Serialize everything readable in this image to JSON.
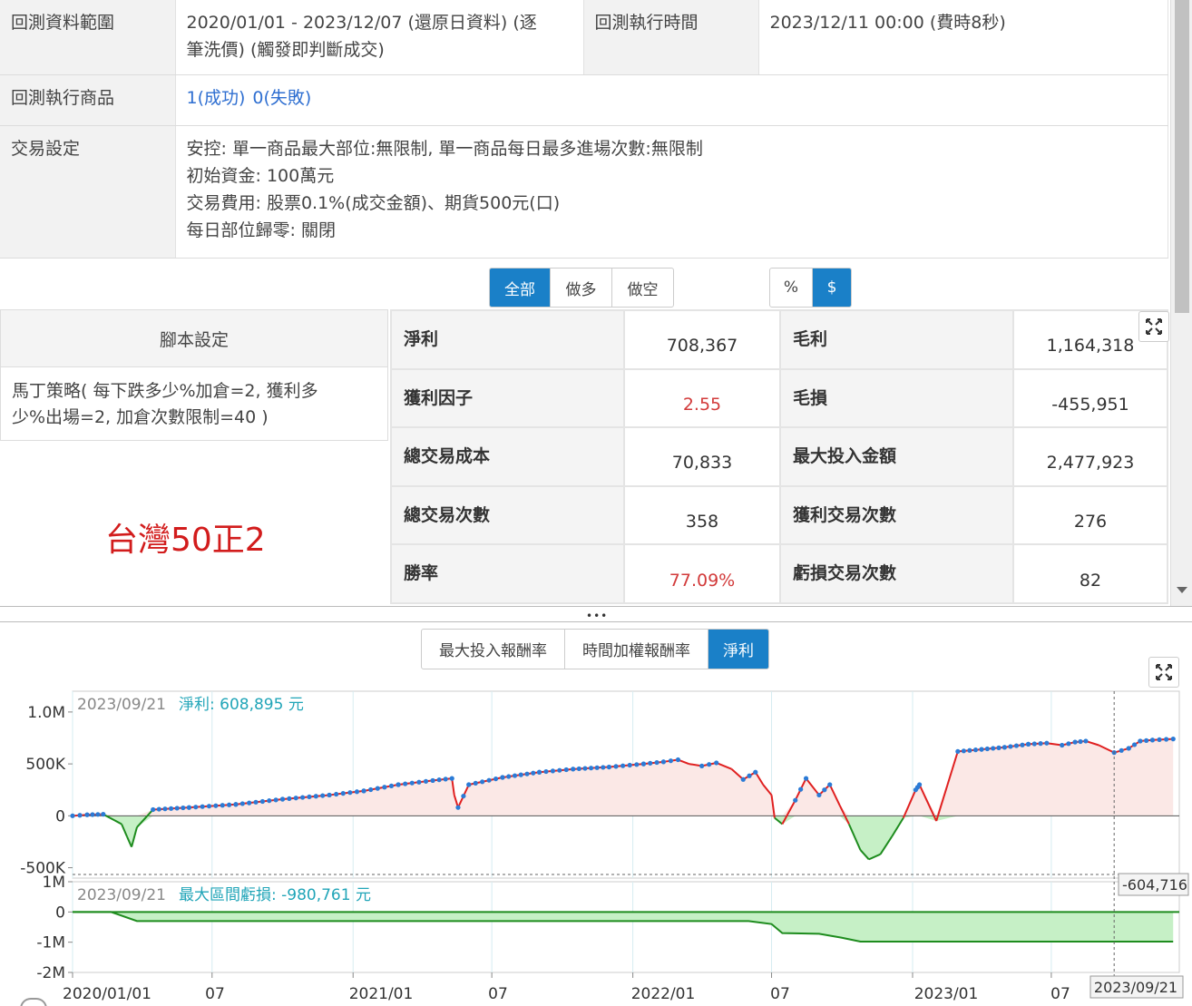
{
  "info": {
    "range_label": "回測資料範圍",
    "range_value_line1": "2020/01/01 - 2023/12/07 (還原日資料) (逐",
    "range_value_line2": "筆洗價) (觸發即判斷成交)",
    "exec_time_label": "回測執行時間",
    "exec_time_value": "2023/12/11 00:00 (費時8秒)",
    "products_label": "回測執行商品",
    "products_success": "1(成功)",
    "products_fail": "0(失敗)",
    "trade_label": "交易設定",
    "trade_lines": [
      "安控: 單一商品最大部位:無限制, 單一商品每日最多進場次數:無限制",
      "初始資金: 100萬元",
      "交易費用: 股票0.1%(成交金額)、期貨500元(口)",
      "每日部位歸零: 關閉"
    ]
  },
  "direction_buttons": [
    "全部",
    "做多",
    "做空"
  ],
  "unit_buttons": [
    "%",
    "$"
  ],
  "script": {
    "header": "腳本設定",
    "body_line1": "馬丁策略( 每下跌多少%加倉=2, 獲利多",
    "body_line2": "少%出場=2, 加倉次數限制=40 )"
  },
  "red_title": "台灣50正2",
  "stats": [
    {
      "k1": "淨利",
      "v1": "708,367",
      "k2": "毛利",
      "v2": "1,164,318"
    },
    {
      "k1": "獲利因子",
      "v1": "2.55",
      "k2": "毛損",
      "v2": "-455,951"
    },
    {
      "k1": "總交易成本",
      "v1": "70,833",
      "k2": "最大投入金額",
      "v2": "2,477,923"
    },
    {
      "k1": "總交易次數",
      "v1": "358",
      "k2": "獲利交易次數",
      "v2": "276"
    },
    {
      "k1": "勝率",
      "v1": "77.09%",
      "k2": "虧損交易次數",
      "v2": "82"
    }
  ],
  "chart_tabs": [
    "最大投入報酬率",
    "時間加權報酬率",
    "淨利"
  ],
  "colors": {
    "accent": "#1a80c8",
    "profit_line_red": "#e02020",
    "loss_green": "#1e8c1e",
    "marker_blue": "#2b7bd6",
    "fill_pink": "#fbe8e6",
    "fill_green": "#c6f0c6",
    "tooltip_teal": "#21a5b8",
    "red_text": "#d21c1c"
  },
  "chart_data": [
    {
      "type": "area",
      "name": "net-profit",
      "tooltip_date": "2023/09/21",
      "tooltip_label": "淨利: 608,895 元",
      "y_ticks": [
        "1.0M",
        "500K",
        "0",
        "-500K"
      ],
      "ylim": [
        -600000,
        1200000
      ],
      "crosshair_label": "-604,716",
      "x": [
        "2020-01-01",
        "2020-01-20",
        "2020-02-10",
        "2020-03-05",
        "2020-03-12",
        "2020-03-18",
        "2020-03-25",
        "2020-04-15",
        "2020-06-01",
        "2020-08-01",
        "2020-10-01",
        "2020-12-01",
        "2021-01-15",
        "2021-03-01",
        "2021-04-15",
        "2021-05-10",
        "2021-05-13",
        "2021-05-18",
        "2021-06-01",
        "2021-07-15",
        "2021-09-01",
        "2021-10-15",
        "2021-12-01",
        "2022-01-15",
        "2022-02-10",
        "2022-03-01",
        "2022-03-15",
        "2022-04-01",
        "2022-04-20",
        "2022-05-10",
        "2022-05-25",
        "2022-06-10",
        "2022-06-20",
        "2022-07-01",
        "2022-07-05",
        "2022-07-15",
        "2022-08-01",
        "2022-08-15",
        "2022-09-01",
        "2022-09-15",
        "2022-09-28",
        "2022-10-10",
        "2022-10-25",
        "2022-11-05",
        "2022-11-20",
        "2022-12-05",
        "2022-12-20",
        "2023-01-05",
        "2023-01-10",
        "2023-02-01",
        "2023-03-01",
        "2023-04-01",
        "2023-05-01",
        "2023-06-01",
        "2023-06-25",
        "2023-07-15",
        "2023-08-01",
        "2023-08-15",
        "2023-09-01",
        "2023-09-21",
        "2023-10-10",
        "2023-10-25",
        "2023-11-10",
        "2023-12-07"
      ],
      "values": [
        0,
        10000,
        15000,
        -80000,
        -200000,
        -300000,
        -110000,
        60000,
        80000,
        110000,
        160000,
        200000,
        240000,
        300000,
        340000,
        360000,
        200000,
        80000,
        300000,
        370000,
        420000,
        450000,
        470000,
        500000,
        520000,
        540000,
        500000,
        480000,
        510000,
        450000,
        350000,
        420000,
        300000,
        200000,
        -20000,
        -80000,
        150000,
        360000,
        200000,
        300000,
        100000,
        -80000,
        -330000,
        -420000,
        -370000,
        -200000,
        -20000,
        250000,
        300000,
        -50000,
        620000,
        640000,
        660000,
        690000,
        700000,
        680000,
        710000,
        720000,
        680000,
        608895,
        650000,
        720000,
        730000,
        740000
      ]
    },
    {
      "type": "area",
      "name": "max-drawdown",
      "tooltip_date": "2023/09/21",
      "tooltip_label": "最大區間虧損: -980,761 元",
      "y_ticks": [
        "1M",
        "0",
        "-1M",
        "-2M"
      ],
      "ylim": [
        -2000000,
        1000000
      ],
      "x": [
        "2020-01-01",
        "2020-02-20",
        "2020-03-25",
        "2022-06-01",
        "2022-07-01",
        "2022-07-15",
        "2022-09-01",
        "2022-09-30",
        "2022-10-25",
        "2023-12-07"
      ],
      "values": [
        0,
        0,
        -300000,
        -300000,
        -400000,
        -700000,
        -720000,
        -850000,
        -980761,
        -980761
      ]
    }
  ],
  "x_axis_labels": [
    "2020/01/01",
    "07",
    "2021/01",
    "07",
    "2022/01",
    "07",
    "2023/01",
    "07"
  ],
  "x_axis_highlight": "2023/09/21"
}
